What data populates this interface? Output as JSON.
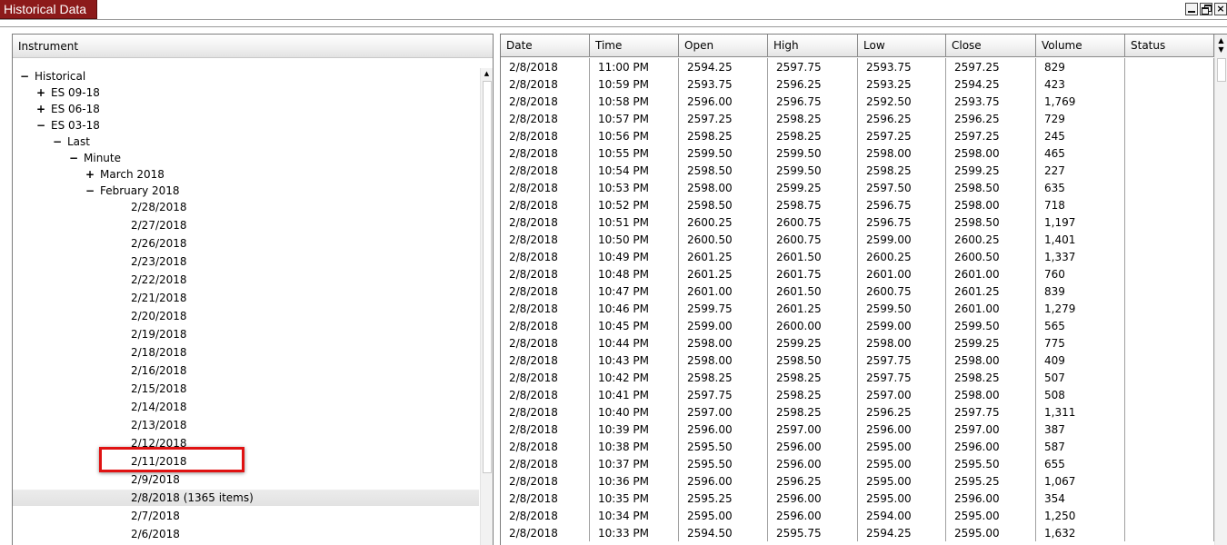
{
  "window": {
    "title": "Historical Data",
    "controls": {
      "minimize": "minimize",
      "restore": "restore",
      "close": "×"
    }
  },
  "tree_panel": {
    "header": "Instrument",
    "items": [
      {
        "label": "Historical",
        "toggle": "−",
        "level": 0
      },
      {
        "label": "ES 09-18",
        "toggle": "+",
        "level": 1
      },
      {
        "label": "ES 06-18",
        "toggle": "+",
        "level": 1
      },
      {
        "label": "ES 03-18",
        "toggle": "−",
        "level": 1
      },
      {
        "label": "Last",
        "toggle": "−",
        "level": 2
      },
      {
        "label": "Minute",
        "toggle": "−",
        "level": 3
      },
      {
        "label": "March 2018",
        "toggle": "+",
        "level": 4
      },
      {
        "label": "February 2018",
        "toggle": "−",
        "level": 4
      },
      {
        "label": "2/28/2018",
        "toggle": "",
        "level": 6
      },
      {
        "label": "2/27/2018",
        "toggle": "",
        "level": 6
      },
      {
        "label": "2/26/2018",
        "toggle": "",
        "level": 6
      },
      {
        "label": "2/23/2018",
        "toggle": "",
        "level": 6
      },
      {
        "label": "2/22/2018",
        "toggle": "",
        "level": 6
      },
      {
        "label": "2/21/2018",
        "toggle": "",
        "level": 6
      },
      {
        "label": "2/20/2018",
        "toggle": "",
        "level": 6
      },
      {
        "label": "2/19/2018",
        "toggle": "",
        "level": 6
      },
      {
        "label": "2/18/2018",
        "toggle": "",
        "level": 6
      },
      {
        "label": "2/16/2018",
        "toggle": "",
        "level": 6
      },
      {
        "label": "2/15/2018",
        "toggle": "",
        "level": 6
      },
      {
        "label": "2/14/2018",
        "toggle": "",
        "level": 6
      },
      {
        "label": "2/13/2018",
        "toggle": "",
        "level": 6
      },
      {
        "label": "2/12/2018",
        "toggle": "",
        "level": 6
      },
      {
        "label": "2/11/2018",
        "toggle": "",
        "level": 6
      },
      {
        "label": "2/9/2018",
        "toggle": "",
        "level": 6
      },
      {
        "label": "2/8/2018 (1365 items)",
        "toggle": "",
        "level": 6,
        "selected": true
      },
      {
        "label": "2/7/2018",
        "toggle": "",
        "level": 6
      },
      {
        "label": "2/6/2018",
        "toggle": "",
        "level": 6
      }
    ]
  },
  "grid": {
    "columns": [
      "Date",
      "Time",
      "Open",
      "High",
      "Low",
      "Close",
      "Volume",
      "Status"
    ],
    "rows": [
      [
        "2/8/2018",
        "11:00 PM",
        "2594.25",
        "2597.75",
        "2593.75",
        "2597.25",
        "829",
        ""
      ],
      [
        "2/8/2018",
        "10:59 PM",
        "2593.75",
        "2596.25",
        "2593.25",
        "2594.25",
        "423",
        ""
      ],
      [
        "2/8/2018",
        "10:58 PM",
        "2596.00",
        "2596.75",
        "2592.50",
        "2593.75",
        "1,769",
        ""
      ],
      [
        "2/8/2018",
        "10:57 PM",
        "2597.25",
        "2598.25",
        "2596.25",
        "2596.25",
        "729",
        ""
      ],
      [
        "2/8/2018",
        "10:56 PM",
        "2598.25",
        "2598.25",
        "2597.25",
        "2597.25",
        "245",
        ""
      ],
      [
        "2/8/2018",
        "10:55 PM",
        "2599.50",
        "2599.50",
        "2598.00",
        "2598.00",
        "465",
        ""
      ],
      [
        "2/8/2018",
        "10:54 PM",
        "2598.50",
        "2599.50",
        "2598.25",
        "2599.25",
        "227",
        ""
      ],
      [
        "2/8/2018",
        "10:53 PM",
        "2598.00",
        "2599.25",
        "2597.50",
        "2598.50",
        "635",
        ""
      ],
      [
        "2/8/2018",
        "10:52 PM",
        "2598.50",
        "2598.75",
        "2596.75",
        "2598.00",
        "718",
        ""
      ],
      [
        "2/8/2018",
        "10:51 PM",
        "2600.25",
        "2600.75",
        "2596.75",
        "2598.50",
        "1,197",
        ""
      ],
      [
        "2/8/2018",
        "10:50 PM",
        "2600.50",
        "2600.75",
        "2599.00",
        "2600.25",
        "1,401",
        ""
      ],
      [
        "2/8/2018",
        "10:49 PM",
        "2601.25",
        "2601.50",
        "2600.25",
        "2600.50",
        "1,337",
        ""
      ],
      [
        "2/8/2018",
        "10:48 PM",
        "2601.25",
        "2601.75",
        "2601.00",
        "2601.00",
        "760",
        ""
      ],
      [
        "2/8/2018",
        "10:47 PM",
        "2601.00",
        "2601.50",
        "2600.75",
        "2601.25",
        "839",
        ""
      ],
      [
        "2/8/2018",
        "10:46 PM",
        "2599.75",
        "2601.25",
        "2599.50",
        "2601.00",
        "1,279",
        ""
      ],
      [
        "2/8/2018",
        "10:45 PM",
        "2599.00",
        "2600.00",
        "2599.00",
        "2599.50",
        "565",
        ""
      ],
      [
        "2/8/2018",
        "10:44 PM",
        "2598.00",
        "2599.25",
        "2598.00",
        "2599.25",
        "775",
        ""
      ],
      [
        "2/8/2018",
        "10:43 PM",
        "2598.00",
        "2598.50",
        "2597.75",
        "2598.00",
        "409",
        ""
      ],
      [
        "2/8/2018",
        "10:42 PM",
        "2598.25",
        "2598.25",
        "2597.75",
        "2598.25",
        "507",
        ""
      ],
      [
        "2/8/2018",
        "10:41 PM",
        "2597.75",
        "2598.25",
        "2597.00",
        "2598.00",
        "508",
        ""
      ],
      [
        "2/8/2018",
        "10:40 PM",
        "2597.00",
        "2598.25",
        "2596.25",
        "2597.75",
        "1,311",
        ""
      ],
      [
        "2/8/2018",
        "10:39 PM",
        "2596.00",
        "2597.00",
        "2596.00",
        "2597.00",
        "387",
        ""
      ],
      [
        "2/8/2018",
        "10:38 PM",
        "2595.50",
        "2596.00",
        "2595.00",
        "2596.00",
        "587",
        ""
      ],
      [
        "2/8/2018",
        "10:37 PM",
        "2595.50",
        "2596.00",
        "2595.00",
        "2595.50",
        "655",
        ""
      ],
      [
        "2/8/2018",
        "10:36 PM",
        "2596.00",
        "2596.25",
        "2595.00",
        "2595.25",
        "1,067",
        ""
      ],
      [
        "2/8/2018",
        "10:35 PM",
        "2595.25",
        "2596.00",
        "2595.00",
        "2596.00",
        "354",
        ""
      ],
      [
        "2/8/2018",
        "10:34 PM",
        "2595.00",
        "2596.00",
        "2594.00",
        "2595.00",
        "1,250",
        ""
      ],
      [
        "2/8/2018",
        "10:33 PM",
        "2594.50",
        "2595.75",
        "2594.25",
        "2595.00",
        "1,632",
        ""
      ]
    ]
  },
  "colors": {
    "title_tab": "#8c1a1a",
    "selection_highlight": "#e01212"
  }
}
